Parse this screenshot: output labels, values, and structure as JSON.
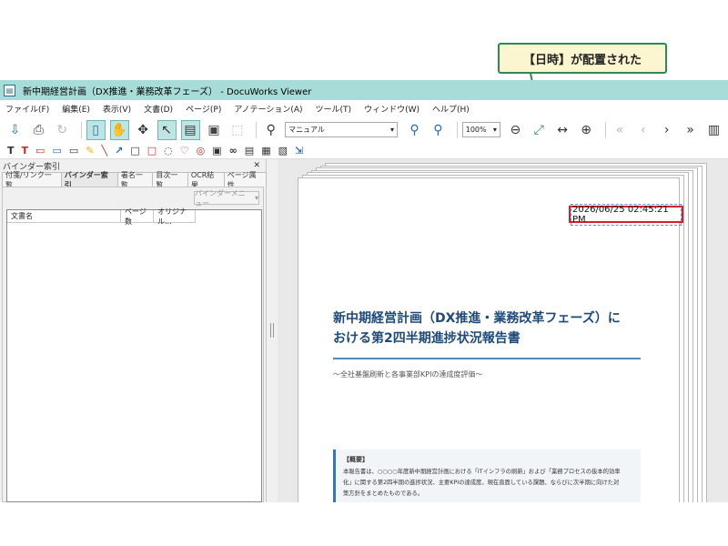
{
  "callout": {
    "text": "【日時】が配置された"
  },
  "window": {
    "title": "新中期経営計画（DX推進・業務改革フェーズ） - DocuWorks Viewer"
  },
  "menubar": [
    "ファイル(F)",
    "編集(E)",
    "表示(V)",
    "文書(D)",
    "ページ(P)",
    "アノテーション(A)",
    "ツール(T)",
    "ウィンドウ(W)",
    "ヘルプ(H)"
  ],
  "toolbar": {
    "search_value": "マニュアル",
    "zoom_value": "100%"
  },
  "left_panel": {
    "title": "バインダー索引",
    "tabs": [
      "付箋/リンク一覧",
      "バインダー索引",
      "署名一覧",
      "目次一覧",
      "OCR結果",
      "ページ属性"
    ],
    "binder_menu_label": "バインダーメニュー",
    "columns": [
      "文書名",
      "ページ数",
      "オリジナル..."
    ]
  },
  "document": {
    "date_stamp": "2026/06/25 02:45:21 PM",
    "title_line1": "新中期経営計画（DX推進・業務改革フェーズ）に",
    "title_line2": "おける第2四半期進捗状況報告書",
    "subtitle": "～全社基盤刷新と各事業部KPIの達成度評価～",
    "summary_heading": "【概要】",
    "summary_line1": "本報告書は、○○○○年度新中期経営計画における「ITインフラの刷新」および「業務プロセスの抜本的効率",
    "summary_line2": "化」に関する第2四半期の進捗状況、主要KPIの達成度、現在直面している課題、ならびに次半期に向けた対",
    "summary_line3": "策方針をまとめたものである。"
  },
  "colors": {
    "titlebar": "#a8dcd9",
    "highlight_box": "#d61f26",
    "callout_border": "#2b8a57",
    "callout_fill": "#fbf6cf",
    "doc_title": "#1e4a78"
  }
}
